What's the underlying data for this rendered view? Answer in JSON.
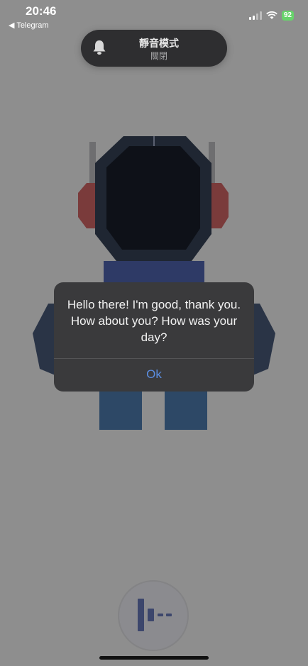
{
  "status_bar": {
    "time": "20:46",
    "back_app": "◀ Telegram",
    "battery": "92"
  },
  "silent_mode": {
    "title": "靜音模式",
    "subtitle": "關閉",
    "icon": "bell-icon"
  },
  "alert": {
    "message": "Hello there! I'm good, thank you. How about you? How was your day?",
    "ok_label": "Ok"
  },
  "mic_button": {
    "icon": "audio-bars-icon"
  },
  "colors": {
    "background": "#8e8e8e",
    "alert_bg": "#3a3a3c",
    "accent_blue": "#5b8de0",
    "battery_green": "#67d36b"
  }
}
